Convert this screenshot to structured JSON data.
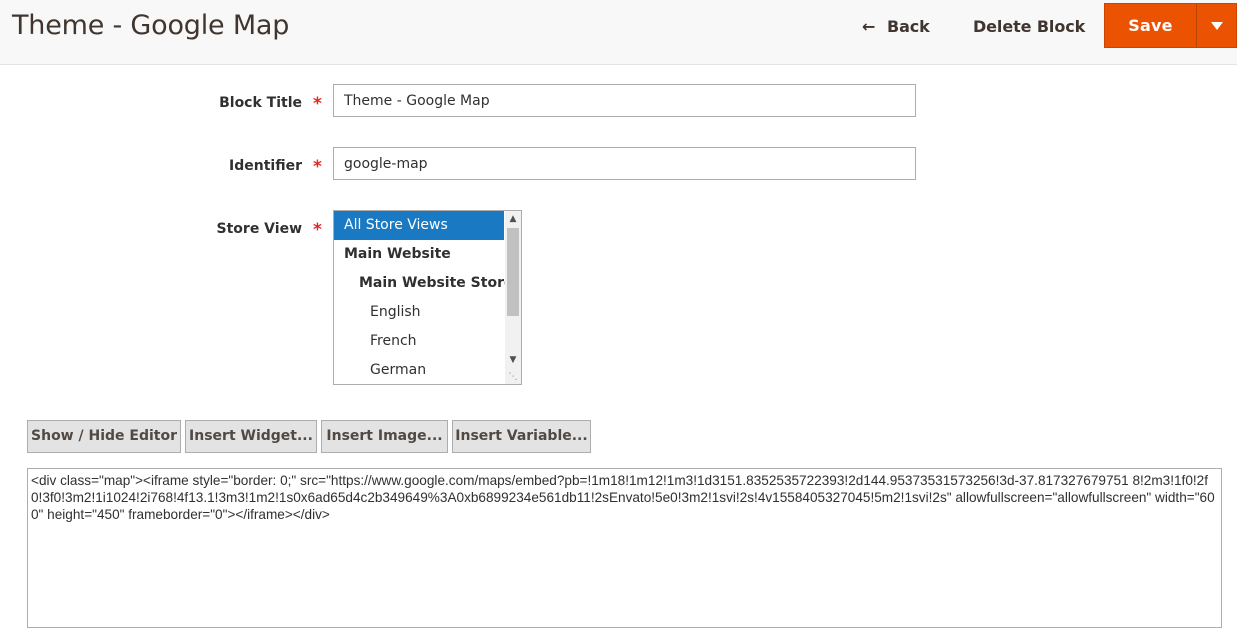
{
  "header": {
    "title": "Theme - Google Map",
    "back_label": "Back",
    "delete_label": "Delete Block",
    "save_label": "Save",
    "accent_color": "#eb5202"
  },
  "form": {
    "block_title": {
      "label": "Block Title",
      "value": "Theme - Google Map"
    },
    "identifier": {
      "label": "Identifier",
      "value": "google-map"
    },
    "store_view": {
      "label": "Store View",
      "options": [
        {
          "label": "All Store Views",
          "selected": true
        },
        {
          "label": "Main Website",
          "selected": false
        },
        {
          "label": "Main Website Store",
          "selected": false
        },
        {
          "label": "English",
          "selected": false
        },
        {
          "label": "French",
          "selected": false
        },
        {
          "label": "German",
          "selected": false
        }
      ]
    },
    "required_mark": "*"
  },
  "editor_toolbar": {
    "show_hide": "Show / Hide Editor",
    "insert_widget": "Insert Widget...",
    "insert_image": "Insert Image...",
    "insert_variable": "Insert Variable..."
  },
  "content": {
    "value": "<div class=\"map\"><iframe style=\"border: 0;\" src=\"https://www.google.com/maps/embed?pb=!1m18!1m12!1m3!1d3151.8352535722393!2d144.95373531573256!3d-37.817327679751 8!2m3!1f0!2f0!3f0!3m2!1i1024!2i768!4f13.1!3m3!1m2!1s0x6ad65d4c2b349649%3A0xb6899234e561db11!2sEnvato!5e0!3m2!1svi!2s!4v1558405327045!5m2!1svi!2s\" allowfullscreen=\"allowfullscreen\" width=\"600\" height=\"450\" frameborder=\"0\"></iframe></div>"
  }
}
